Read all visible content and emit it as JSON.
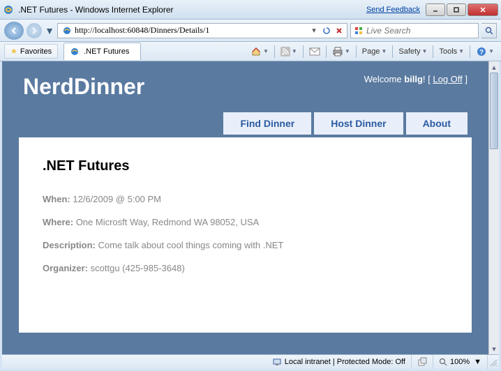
{
  "window": {
    "title": ".NET Futures - Windows Internet Explorer",
    "feedback": "Send Feedback"
  },
  "address": {
    "url": "http://localhost:60848/Dinners/Details/1"
  },
  "search": {
    "placeholder": "Live Search"
  },
  "favorites": {
    "label": "Favorites"
  },
  "tab": {
    "title": ".NET Futures"
  },
  "menu": {
    "page": "Page",
    "safety": "Safety",
    "tools": "Tools"
  },
  "site": {
    "brand": "NerdDinner",
    "welcome_pre": "Welcome ",
    "username": "billg",
    "welcome_post": "! [ ",
    "logoff": "Log Off",
    "welcome_end": " ]",
    "nav": {
      "find": "Find Dinner",
      "host": "Host Dinner",
      "about": "About"
    }
  },
  "dinner": {
    "title": ".NET Futures",
    "when_label": "When:",
    "when": "12/6/2009 @ 5:00 PM",
    "where_label": "Where:",
    "where": "One Microsft Way, Redmond WA 98052, USA",
    "desc_label": "Description:",
    "desc": "Come talk about cool things coming with .NET",
    "org_label": "Organizer:",
    "org": "scottgu (425-985-3648)"
  },
  "status": {
    "zone": "Local intranet | Protected Mode: Off",
    "zoom": "100%"
  }
}
